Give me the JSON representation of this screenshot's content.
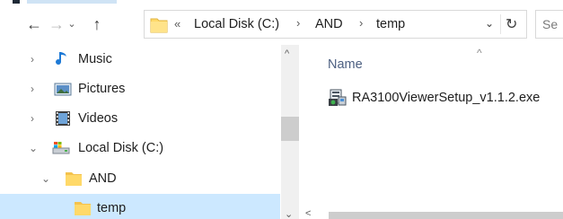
{
  "navigation": {
    "back_icon": "arrow-left-icon",
    "forward_icon": "arrow-right-icon",
    "recent_icon": "chevron-down-icon",
    "up_icon": "arrow-up-icon",
    "back_glyph": "←",
    "forward_glyph": "→",
    "recent_glyph": "⌄",
    "up_glyph": "↑"
  },
  "address_bar": {
    "overflow_glyph": "«",
    "separator_glyph": "›",
    "crumbs": [
      "Local Disk (C:)",
      "AND",
      "temp"
    ],
    "dropdown_glyph": "⌄",
    "refresh_glyph": "↻"
  },
  "search": {
    "placeholder": "Se"
  },
  "tree": {
    "items": [
      {
        "label": "Music",
        "icon": "music-note-icon",
        "expanded": false
      },
      {
        "label": "Pictures",
        "icon": "pictures-icon",
        "expanded": false
      },
      {
        "label": "Videos",
        "icon": "videos-icon",
        "expanded": false
      },
      {
        "label": "Local Disk (C:)",
        "icon": "drive-icon",
        "expanded": true
      },
      {
        "label": "AND",
        "icon": "folder-icon",
        "expanded": true
      },
      {
        "label": "temp",
        "icon": "folder-icon",
        "selected": true
      }
    ],
    "collapsed_glyph": "›",
    "expanded_glyph": "⌄"
  },
  "content": {
    "column_header": "Name",
    "sort_glyph": "^",
    "files": [
      {
        "name": "RA3100ViewerSetup_v1.1.2.exe",
        "icon": "installer-icon"
      }
    ]
  },
  "scrollbar": {
    "up_glyph": "^",
    "down_glyph": "⌄",
    "left_glyph": "<"
  },
  "colors": {
    "selection": "#cce8ff",
    "folder": "#ffd969",
    "header_text": "#4d6082"
  }
}
